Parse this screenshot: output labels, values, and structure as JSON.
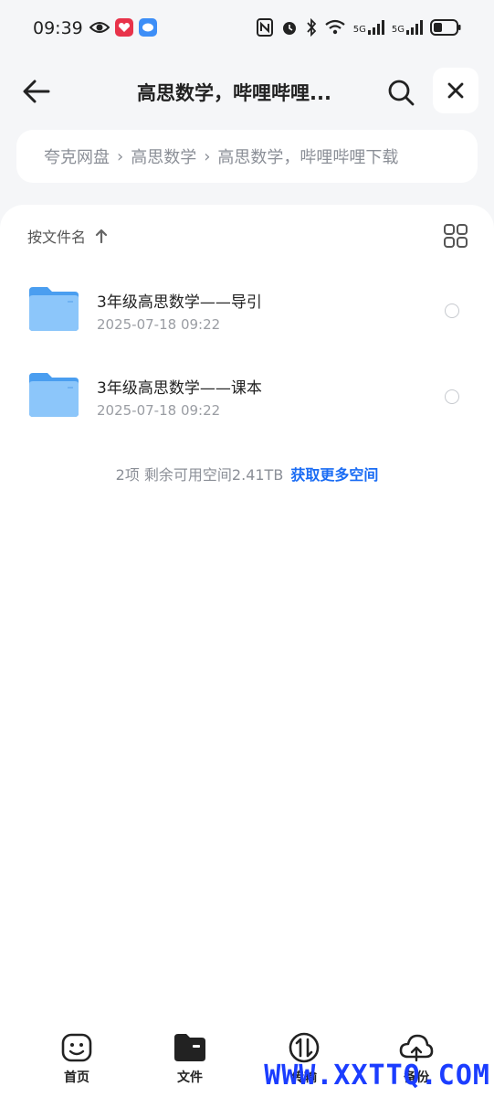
{
  "status": {
    "time": "09:39",
    "net1": "5G",
    "net2": "5G"
  },
  "header": {
    "title": "高思数学，哔哩哔哩..."
  },
  "breadcrumb": {
    "items": [
      "夸克网盘",
      "高思数学",
      "高思数学，哔哩哔哩下载"
    ]
  },
  "sort": {
    "label": "按文件名"
  },
  "files": [
    {
      "name": "3年级高思数学——导引",
      "date": "2025-07-18 09:22"
    },
    {
      "name": "3年级高思数学——课本",
      "date": "2025-07-18 09:22"
    }
  ],
  "footer": {
    "info": "2项 剩余可用空间2.41TB",
    "link": "获取更多空间"
  },
  "tabs": [
    {
      "label": "首页",
      "icon": "smile-icon"
    },
    {
      "label": "文件",
      "icon": "folder-tab-icon"
    },
    {
      "label": "传输",
      "icon": "transfer-icon"
    },
    {
      "label": "备份",
      "icon": "cloud-icon"
    }
  ],
  "watermark": "WWW.XXTTQ.COM",
  "colors": {
    "accent": "#1a6cf4",
    "folder": "#5aaaf2"
  }
}
